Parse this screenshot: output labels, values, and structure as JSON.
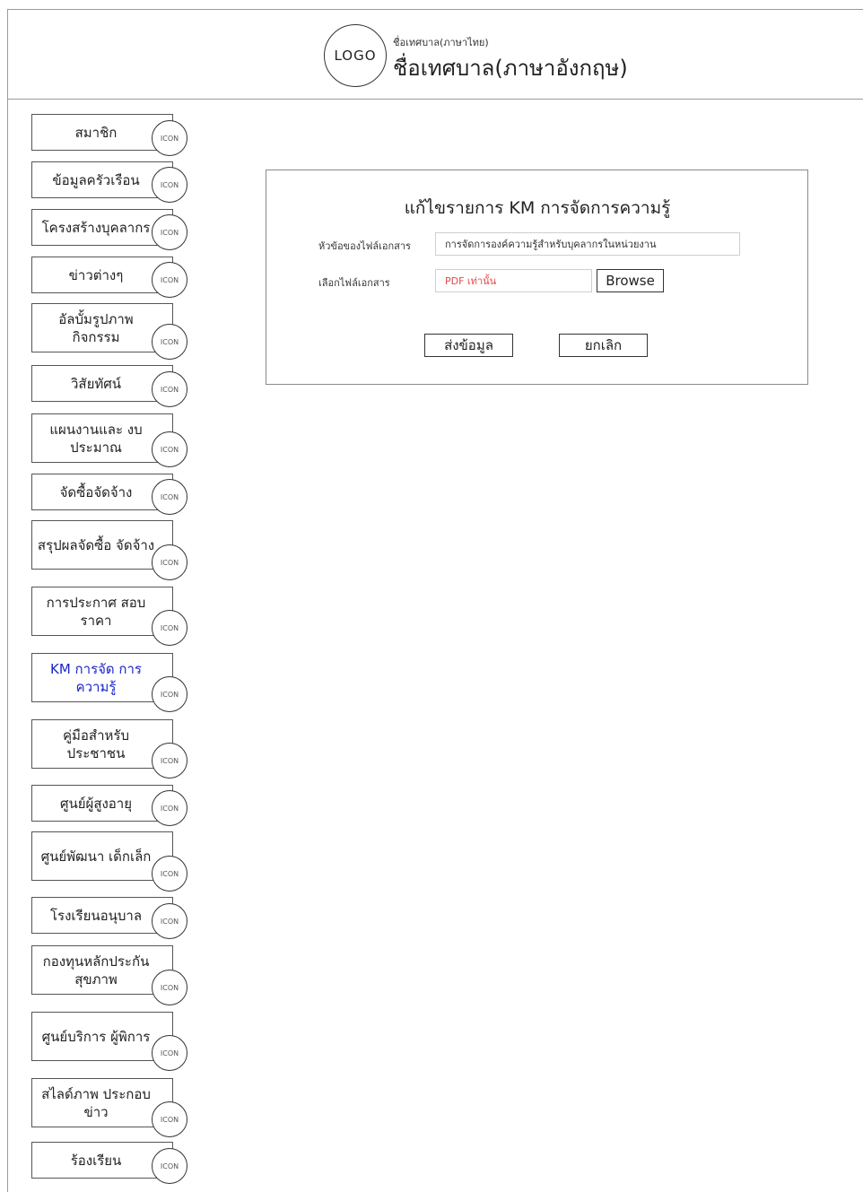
{
  "header": {
    "logo_text": "LOGO",
    "org_name_th": "ชื่อเทศบาล(ภาษาไทย)",
    "org_name_en": "ชื่อเทศบาล(ภาษาอังกฤษ)"
  },
  "sidebar": {
    "icon_label": "ICON",
    "items": [
      {
        "label": "สมาชิก"
      },
      {
        "label": "ข้อมูลครัวเรือน"
      },
      {
        "label": "โครงสร้างบุคลากร"
      },
      {
        "label": "ข่าวต่างๆ"
      },
      {
        "label": "อัลบั้มรูปภาพ กิจกรรม"
      },
      {
        "label": "วิสัยทัศน์"
      },
      {
        "label": "แผนงานและ งบประมาณ"
      },
      {
        "label": "จัดซื้อจัดจ้าง"
      },
      {
        "label": "สรุปผลจัดซื้อ จัดจ้าง"
      },
      {
        "label": "การประกาศ สอบราคา"
      },
      {
        "label": "KM การจัด การความรู้",
        "active": true
      },
      {
        "label": "คู่มือสำหรับ ประชาชน"
      },
      {
        "label": "ศูนย์ผู้สูงอายุ"
      },
      {
        "label": "ศูนย์พัฒนา เด็กเล็ก"
      },
      {
        "label": "โรงเรียนอนุบาล"
      },
      {
        "label": "กองทุนหลักประกัน สุขภาพ"
      },
      {
        "label": "ศูนย์บริการ ผู้พิการ"
      },
      {
        "label": "สไลด์ภาพ ประกอบข่าว"
      },
      {
        "label": "ร้องเรียน"
      }
    ]
  },
  "form": {
    "title": "แก้ไขรายการ KM การจัดการความรู้",
    "doc_title_label": "หัวข้อของไฟล์เอกสาร",
    "doc_title_value": "การจัดการองค์ความรู้สำหรับบุคลากรในหน่วยงาน",
    "file_label": "เลือกไฟล์เอกสาร",
    "file_placeholder": "PDF เท่านั้น",
    "browse_label": "Browse",
    "submit_label": "ส่งข้อมูล",
    "cancel_label": "ยกเลิก"
  },
  "colors": {
    "active_menu": "#1a24c8",
    "placeholder": "#e04848",
    "border": "#555555"
  }
}
